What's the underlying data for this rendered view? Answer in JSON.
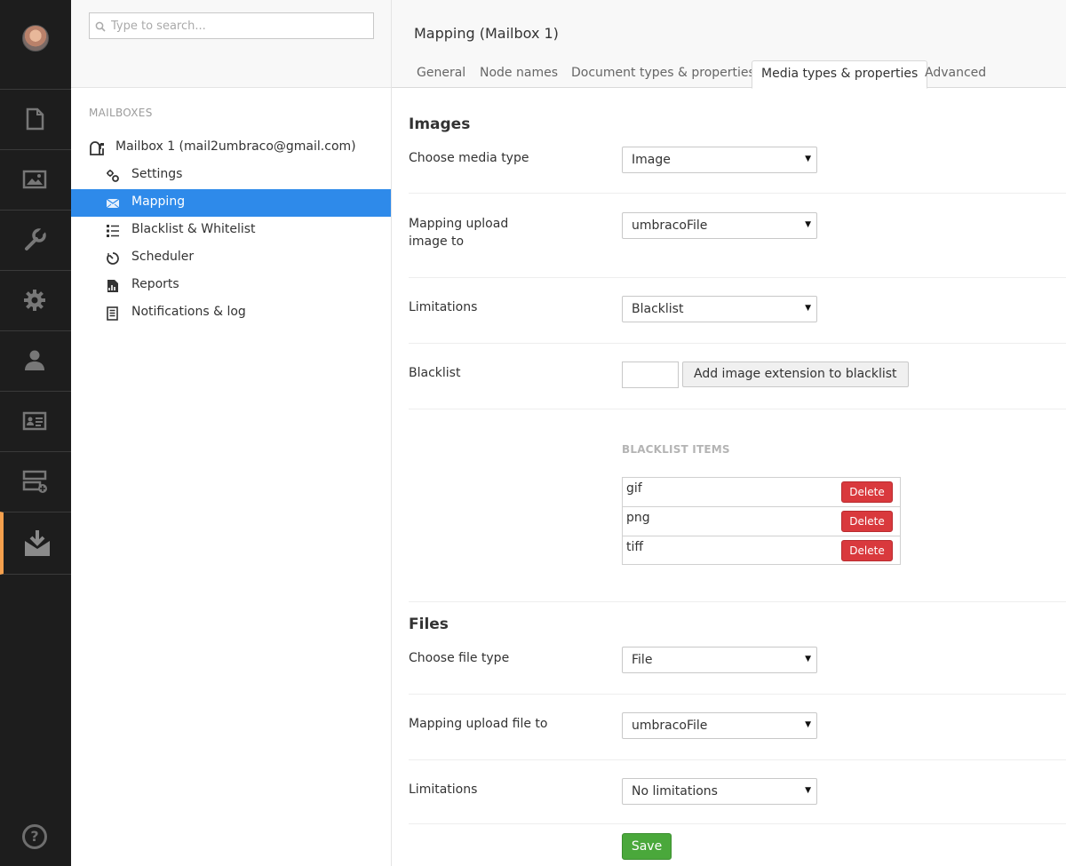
{
  "search": {
    "placeholder": "Type to search..."
  },
  "tree": {
    "heading": "MAILBOXES",
    "root_label": "Mailbox 1 (mail2umbraco@gmail.com)",
    "items": [
      {
        "label": "Settings",
        "icon": "settings-icon"
      },
      {
        "label": "Mapping",
        "icon": "envelope-icon",
        "selected": true
      },
      {
        "label": "Blacklist & Whitelist",
        "icon": "list-icon"
      },
      {
        "label": "Scheduler",
        "icon": "timer-icon"
      },
      {
        "label": "Reports",
        "icon": "report-icon"
      },
      {
        "label": "Notifications & log",
        "icon": "log-icon"
      }
    ]
  },
  "rail": {
    "sections": [
      "content-icon",
      "media-icon",
      "settings-wrench-icon",
      "developer-gear-icon",
      "users-icon",
      "members-icon",
      "forms-icon",
      "mail-download-icon"
    ],
    "accent_color": "#f5a04d"
  },
  "header": {
    "title": "Mapping (Mailbox 1)",
    "tabs": [
      "General",
      "Node names",
      "Document types & properties",
      "Media types & properties",
      "Advanced"
    ],
    "active_tab": "Media types & properties"
  },
  "images": {
    "title": "Images",
    "media_type_label": "Choose media type",
    "media_type_value": "Image",
    "mapping_label": "Mapping upload image to",
    "mapping_value": "umbracoFile",
    "limitations_label": "Limitations",
    "limitations_value": "Blacklist",
    "blacklist_label": "Blacklist",
    "add_button": "Add image extension to blacklist",
    "items_heading": "BLACKLIST ITEMS",
    "items": [
      "gif",
      "png",
      "tiff"
    ],
    "delete_label": "Delete"
  },
  "files": {
    "title": "Files",
    "file_type_label": "Choose file type",
    "file_type_value": "File",
    "mapping_label": "Mapping upload file to",
    "mapping_value": "umbracoFile",
    "limitations_label": "Limitations",
    "limitations_value": "No limitations"
  },
  "save_label": "Save",
  "colors": {
    "selected": "#2e8aea",
    "delete": "#d9393d",
    "save": "#4aa83b"
  }
}
